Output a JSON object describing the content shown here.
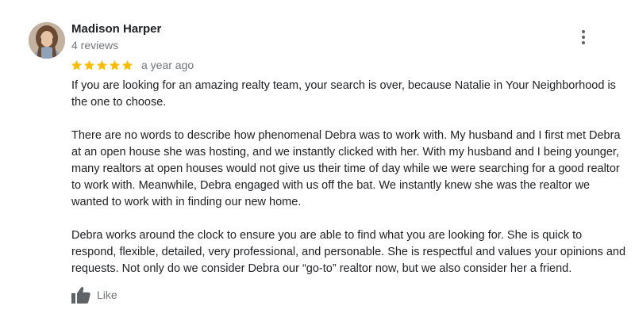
{
  "review": {
    "author_name": "Madison Harper",
    "review_count": "4 reviews",
    "rating": 5,
    "rating_max": 5,
    "time": "a year ago",
    "star_color": "#fbbc04",
    "paragraphs": [
      "If you are looking for an amazing realty team, your search is over, because Natalie in Your Neighborhood is the one to choose.",
      "There are no words to describe how phenomenal Debra was to work with. My husband and I first met Debra at an open house she was hosting, and we instantly clicked with her. With my husband and I being younger, many realtors at open houses would not give us their time of day while we were searching for a good realtor to work with. Meanwhile, Debra engaged with us off the bat. We instantly knew she was the realtor we wanted to work with in finding our new home.",
      "Debra works around the clock to ensure you are able to find what you are looking for. She is quick to respond, flexible, detailed, very professional, and personable. She is respectful and values your opinions and requests. Not only do we consider Debra our “go-to” realtor now, but we also consider her a friend."
    ],
    "like_label": "Like",
    "icons": {
      "avatar": "avatar-photo",
      "more": "more-vert-icon",
      "star": "star-icon",
      "like": "thumb-up-icon"
    }
  }
}
